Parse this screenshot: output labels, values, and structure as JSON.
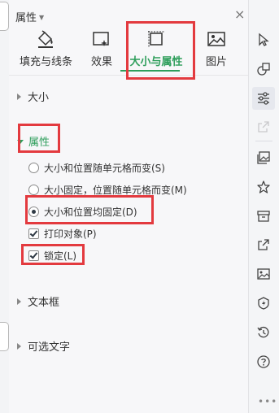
{
  "panel": {
    "title": "属性",
    "close_glyph": "×"
  },
  "tabs": [
    {
      "label": "填充与线条",
      "icon": "fill-bucket-icon"
    },
    {
      "label": "效果",
      "icon": "effects-icon"
    },
    {
      "label": "大小与属性",
      "icon": "size-properties-icon",
      "active": true
    },
    {
      "label": "图片",
      "icon": "picture-icon"
    }
  ],
  "sections": {
    "size": {
      "label": "大小",
      "expanded": false
    },
    "properties": {
      "label": "属性",
      "expanded": true,
      "options": [
        {
          "label": "大小和位置随单元格而变(S)",
          "type": "radio",
          "checked": false
        },
        {
          "label": "大小固定，位置随单元格而变(M)",
          "type": "radio",
          "checked": false
        },
        {
          "label": "大小和位置均固定(D)",
          "type": "radio",
          "checked": true
        },
        {
          "label": "打印对象(P)",
          "type": "checkbox",
          "checked": true
        },
        {
          "label": "锁定(L)",
          "type": "checkbox",
          "checked": true
        }
      ]
    },
    "textbox": {
      "label": "文本框",
      "expanded": false
    },
    "alt_text": {
      "label": "可选文字",
      "expanded": false
    }
  },
  "right_rail": {
    "icons": [
      "pointer-icon",
      "shapes-icon",
      "properties-icon",
      "share-disabled-icon",
      "image-gallery-icon",
      "star-icon",
      "archive-icon",
      "export-icon",
      "picture-icon",
      "shield-icon",
      "history-icon",
      "help-icon"
    ],
    "more_glyph": "•••"
  },
  "colors": {
    "accent_green": "#2e9e5b",
    "highlight_red": "#e33a3f",
    "panel_bg": "#f7f7f9"
  }
}
